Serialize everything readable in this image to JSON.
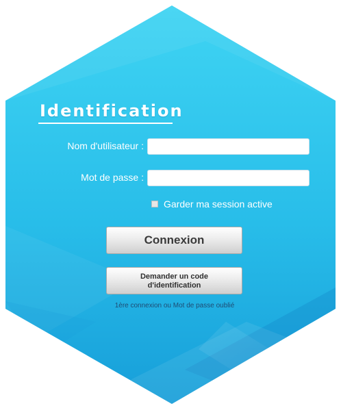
{
  "form": {
    "title": "Identification",
    "username_label": "Nom d'utilisateur :",
    "username_value": "",
    "password_label": "Mot de passe :",
    "password_value": "",
    "remember_label": "Garder ma session active",
    "remember_checked": false,
    "connect_button": "Connexion",
    "request_code_button_line1": "Demander un code",
    "request_code_button_line2": "d'identification",
    "hint": "1ère connexion ou Mot de passe oublié"
  },
  "colors": {
    "hex_top": "#3fd3f3",
    "hex_bottom": "#1aa3dd",
    "text": "#ffffff",
    "hint": "#1f4c74"
  }
}
